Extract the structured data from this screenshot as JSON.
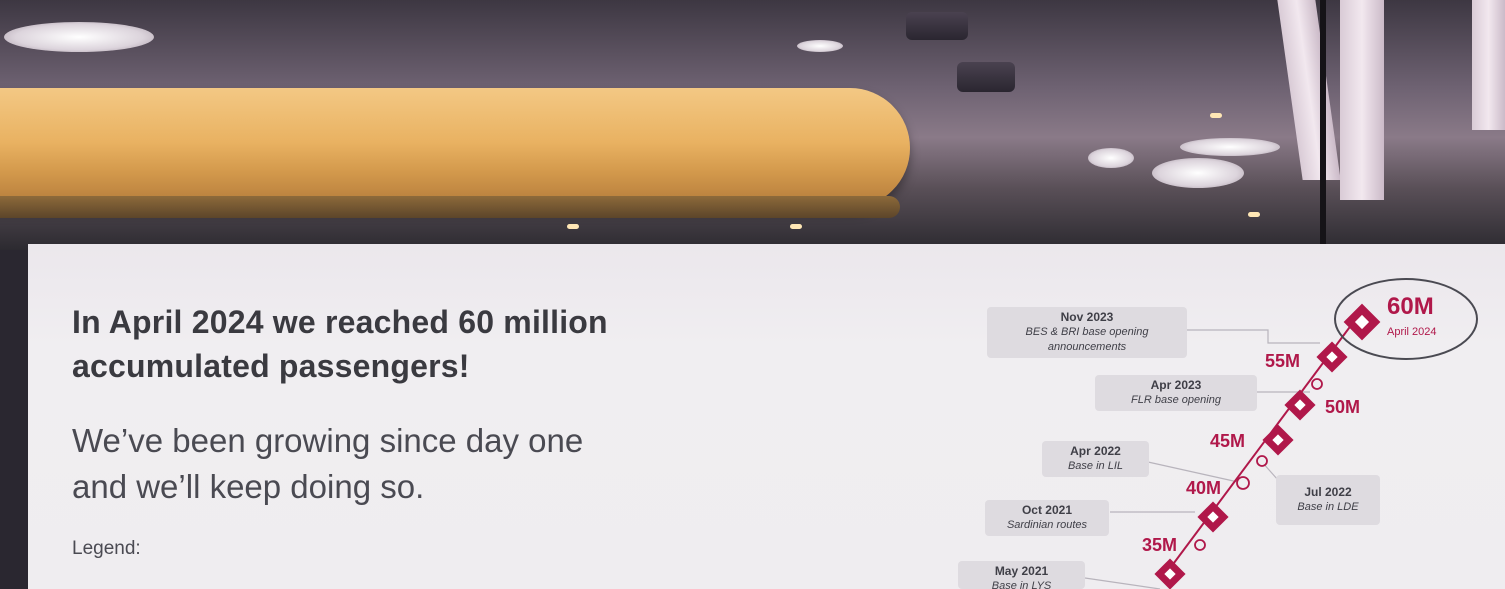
{
  "slide": {
    "headline_line1": "In April 2024 we reached 60 million",
    "headline_line2": "accumulated passengers!",
    "sub_line1": "We’ve been growing since day one",
    "sub_line2": "and we’ll keep doing so.",
    "legend_label": "Legend:"
  },
  "timeline": {
    "milestones": [
      {
        "label": "60M",
        "sub": "April 2024"
      },
      {
        "label": "55M"
      },
      {
        "label": "50M"
      },
      {
        "label": "45M"
      },
      {
        "label": "40M"
      },
      {
        "label": "35M"
      }
    ],
    "events": [
      {
        "date": "Nov 2023",
        "desc_line1": "BES & BRI base opening",
        "desc_line2": "announcements"
      },
      {
        "date": "Apr 2023",
        "desc_line1": "FLR base opening"
      },
      {
        "date": "Apr 2022",
        "desc_line1": "Base in LIL"
      },
      {
        "date": "Jul 2022",
        "desc_line1": "Base in LDE"
      },
      {
        "date": "Oct 2021",
        "desc_line1": "Sardinian routes"
      },
      {
        "date": "May 2021",
        "desc_line1": "Base in LYS"
      }
    ]
  },
  "colors": {
    "accent": "#b0184a",
    "screen": "#efedf0",
    "text": "#3a3a40"
  }
}
